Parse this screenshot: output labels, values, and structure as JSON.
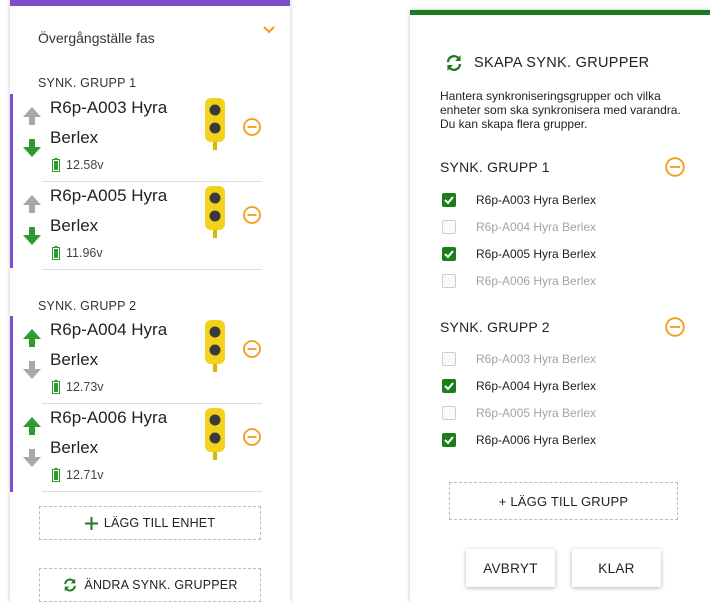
{
  "left_panel": {
    "header": "Övergångställe fas",
    "groups": [
      {
        "title": "SYNK. GRUPP 1",
        "devices": [
          {
            "name_line1": "R6p-A003 Hyra",
            "name_line2": "Berlex",
            "voltage": "12.58v",
            "arrow_up_active": false,
            "arrow_down_active": true
          },
          {
            "name_line1": "R6p-A005 Hyra",
            "name_line2": "Berlex",
            "voltage": "11.96v",
            "arrow_up_active": false,
            "arrow_down_active": true
          }
        ]
      },
      {
        "title": "SYNK. GRUPP 2",
        "devices": [
          {
            "name_line1": "R6p-A004 Hyra",
            "name_line2": "Berlex",
            "voltage": "12.73v",
            "arrow_up_active": true,
            "arrow_down_active": false
          },
          {
            "name_line1": "R6p-A006 Hyra",
            "name_line2": "Berlex",
            "voltage": "12.71v",
            "arrow_up_active": true,
            "arrow_down_active": false
          }
        ]
      }
    ],
    "add_device_label": "LÄGG TILL ENHET",
    "edit_groups_label": "ÄNDRA SYNK. GRUPPER"
  },
  "right_panel": {
    "title": "SKAPA SYNK. GRUPPER",
    "description": "Hantera synkroniseringsgrupper och vilka enheter som ska synkronisera med varandra. Du kan skapa flera grupper.",
    "groups": [
      {
        "title": "SYNK. GRUPP 1",
        "items": [
          {
            "label": "R6p-A003 Hyra Berlex",
            "checked": true
          },
          {
            "label": "R6p-A004 Hyra Berlex",
            "checked": false
          },
          {
            "label": "R6p-A005 Hyra Berlex",
            "checked": true
          },
          {
            "label": "R6p-A006 Hyra Berlex",
            "checked": false
          }
        ]
      },
      {
        "title": "SYNK. GRUPP 2",
        "items": [
          {
            "label": "R6p-A003 Hyra Berlex",
            "checked": false
          },
          {
            "label": "R6p-A004 Hyra Berlex",
            "checked": true
          },
          {
            "label": "R6p-A005 Hyra Berlex",
            "checked": false
          },
          {
            "label": "R6p-A006 Hyra Berlex",
            "checked": true
          }
        ]
      }
    ],
    "add_group_label": "+ LÄGG TILL GRUPP",
    "cancel_label": "AVBRYT",
    "done_label": "KLAR"
  },
  "colors": {
    "accent_purple": "#7b4fc9",
    "accent_green": "#1f7a1f",
    "arrow_active": "#2e9b2e",
    "arrow_inactive": "#a8a8a8",
    "remove_orange": "#f39a1a",
    "light_yellow": "#f2d21b"
  },
  "icons": {
    "chevron": "chevron-down-icon",
    "battery": "battery-icon",
    "traffic_light": "traffic-light-icon",
    "remove": "remove-circle-icon",
    "sync": "sync-icon",
    "plus": "plus-icon"
  }
}
